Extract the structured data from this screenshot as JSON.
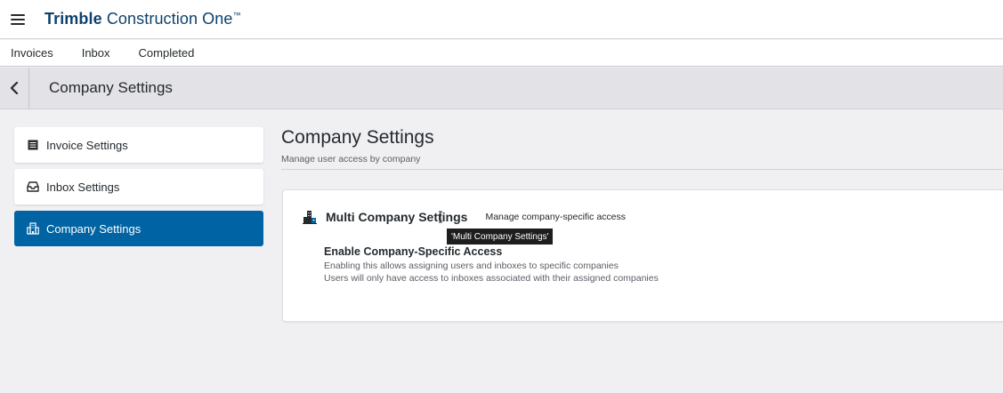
{
  "app": {
    "brand_bold": "Trimble",
    "brand_light": " Construction One",
    "brand_tm": "™"
  },
  "nav": {
    "tabs": [
      {
        "label": "Invoices"
      },
      {
        "label": "Inbox"
      },
      {
        "label": "Completed"
      }
    ]
  },
  "page_header": {
    "title": "Company Settings"
  },
  "sidebar": {
    "items": [
      {
        "label": "Invoice Settings",
        "icon": "list-icon",
        "active": false
      },
      {
        "label": "Inbox Settings",
        "icon": "inbox-icon",
        "active": false
      },
      {
        "label": "Company Settings",
        "icon": "building-icon",
        "active": true
      }
    ]
  },
  "main": {
    "title": "Company Settings",
    "subtitle": "Manage user access by company",
    "card": {
      "title": "Multi Company Settings",
      "description": "Manage company-specific access",
      "tooltip": "'Multi Company Settings'",
      "setting": {
        "title": "Enable Company-Specific Access",
        "line1": "Enabling this allows assigning users and inboxes to specific companies",
        "line2": "Users will only have access to inboxes associated with their assigned companies"
      }
    }
  },
  "colors": {
    "brand": "#0e416c",
    "active": "#0063a3"
  }
}
